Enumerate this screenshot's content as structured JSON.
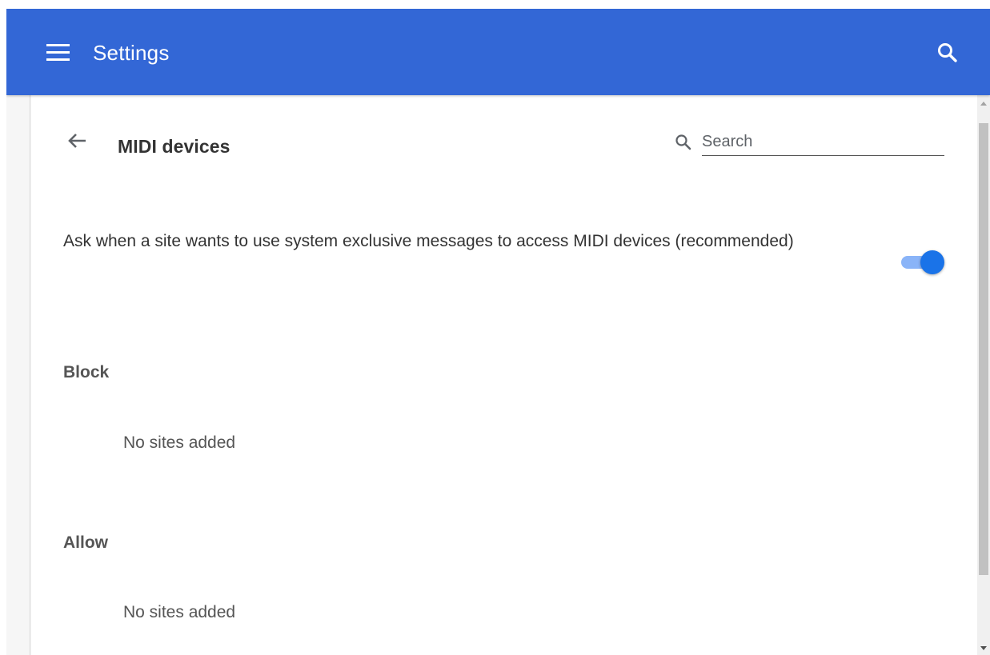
{
  "topbar": {
    "title": "Settings",
    "menu_icon": "hamburger-menu-icon",
    "search_icon": "search-icon",
    "background_color": "#3367d6"
  },
  "subpage": {
    "back_icon": "arrow-back-icon",
    "title": "MIDI devices",
    "search": {
      "placeholder": "Search",
      "value": "",
      "icon": "search-icon"
    }
  },
  "setting": {
    "label": "Ask when a site wants to use system exclusive messages to access MIDI devices (recommended)",
    "toggle_on": true,
    "toggle_color": "#1a73e8"
  },
  "sections": [
    {
      "heading": "Block",
      "empty_text": "No sites added"
    },
    {
      "heading": "Allow",
      "empty_text": "No sites added"
    }
  ]
}
